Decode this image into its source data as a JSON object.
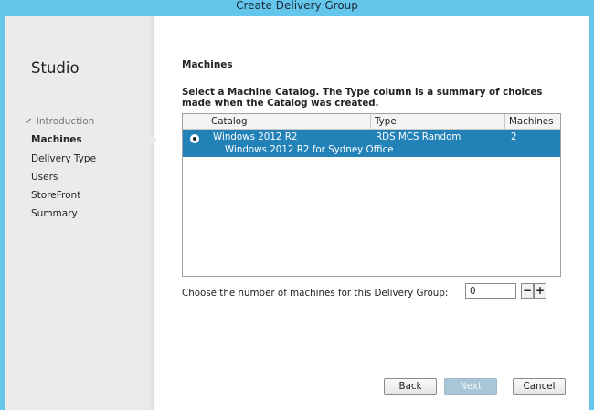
{
  "window": {
    "title": "Create Delivery Group"
  },
  "sidebar": {
    "app_title": "Studio",
    "steps": [
      {
        "label": "Introduction",
        "state": "done"
      },
      {
        "label": "Machines",
        "state": "active"
      },
      {
        "label": "Delivery Type",
        "state": "pending"
      },
      {
        "label": "Users",
        "state": "pending"
      },
      {
        "label": "StoreFront",
        "state": "pending"
      },
      {
        "label": "Summary",
        "state": "pending"
      }
    ],
    "check_icon": "✔"
  },
  "main": {
    "section_title": "Machines",
    "instruction": "Select a Machine Catalog. The Type column is a summary of choices made when the Catalog was created.",
    "table": {
      "columns": [
        "Catalog",
        "Type",
        "Machines"
      ],
      "rows": [
        {
          "selected": true,
          "catalog": "Windows 2012 R2",
          "description": "Windows 2012 R2 for Sydney Office",
          "type": "RDS MCS Random",
          "machines": "2"
        }
      ]
    },
    "machine_count": {
      "label": "Choose the number of machines for this Delivery Group:",
      "value": "0",
      "decrement": "−",
      "increment": "+"
    }
  },
  "buttons": {
    "back": "Back",
    "next": "Next",
    "cancel": "Cancel"
  },
  "colors": {
    "accent": "#63c6ea",
    "selection": "#2281b7",
    "sidebar": "#ebebeb"
  }
}
